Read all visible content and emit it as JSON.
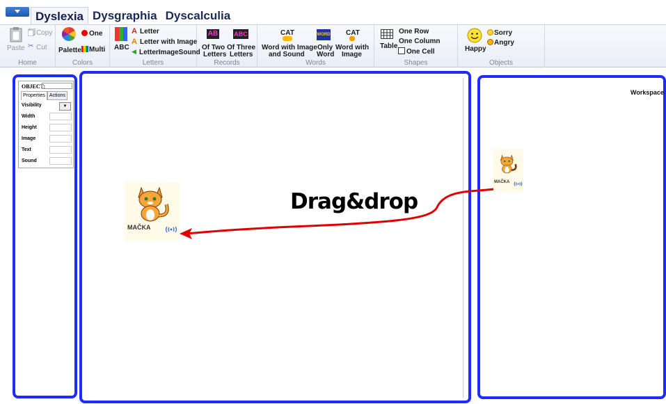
{
  "tabs": [
    "Dyslexia",
    "Dysgraphia",
    "Dyscalculia"
  ],
  "ribbon": {
    "home": {
      "paste": "Paste",
      "copy": "Copy",
      "cut": "Cut",
      "label": "Home"
    },
    "colors": {
      "palette": "Palette",
      "one": "One",
      "multi": "Multi",
      "label": "Colors"
    },
    "letters": {
      "abc": "ABC",
      "letter": "Letter",
      "letter_with_image": "Letter with Image",
      "letter_image_sound": "LetterImageSound",
      "label": "Letters"
    },
    "records": {
      "of_two_1": "Of Two",
      "of_two_2": "Letters",
      "of_three_1": "Of Three",
      "of_three_2": "Letters",
      "label": "Records"
    },
    "words": {
      "wis_1": "Word with Image",
      "wis_2": "and Sound",
      "only_1": "Only",
      "only_2": "Word",
      "wwi_1": "Word with",
      "wwi_2": "Image",
      "cat": "CAT",
      "word_icon": "WORD",
      "label": "Words"
    },
    "shapes": {
      "table": "Table",
      "one_row": "One Row",
      "one_column": "One Column",
      "one_cell": "One Cell",
      "label": "Shapes"
    },
    "objects": {
      "happy": "Happy",
      "sorry": "Sorry",
      "angry": "Angry",
      "label": "Objects"
    }
  },
  "props": {
    "object_label": "OBJECT:",
    "tab_properties": "Properties",
    "tab_actions": "Actions",
    "rows": [
      "Visibility",
      "Width",
      "Height",
      "Image",
      "Text",
      "Sound"
    ]
  },
  "workspace": "Workspace",
  "dragdrop": "Drag&drop",
  "cat_word": "MAČKA",
  "colors": {
    "pane_border": "#1d2bff",
    "arrow": "#e00000"
  }
}
